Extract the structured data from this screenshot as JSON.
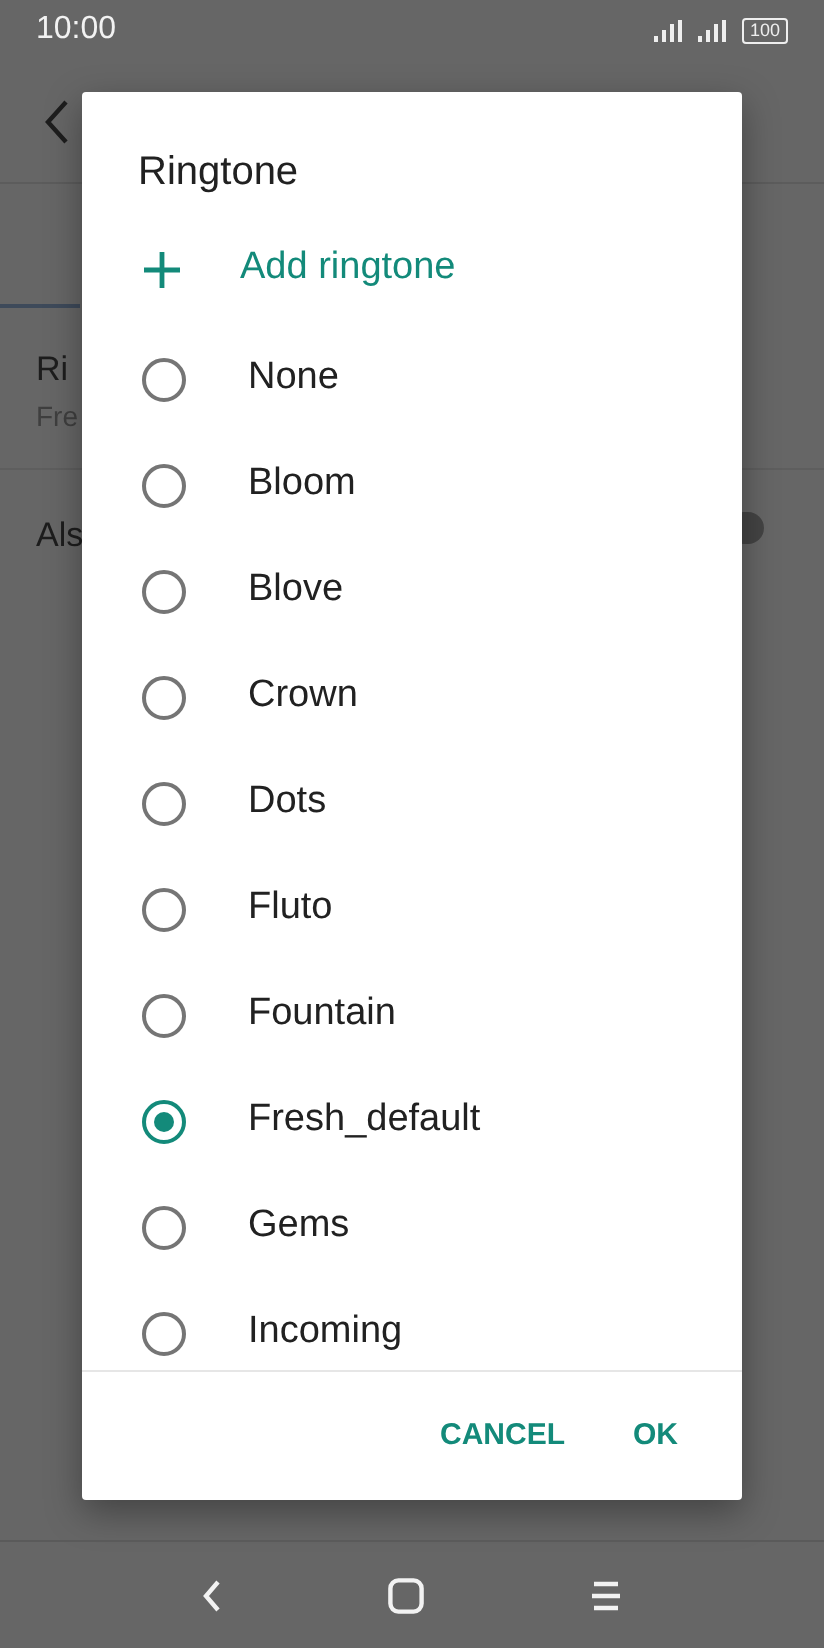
{
  "status_bar": {
    "time": "10:00",
    "battery": "100"
  },
  "background": {
    "setting_title": "Ri",
    "setting_value": "Fre",
    "setting_2": "Als",
    "toggle_on": false
  },
  "dialog": {
    "title": "Ringtone",
    "add_label": "Add ringtone",
    "options": [
      {
        "label": "None",
        "selected": false
      },
      {
        "label": "Bloom",
        "selected": false
      },
      {
        "label": "Blove",
        "selected": false
      },
      {
        "label": "Crown",
        "selected": false
      },
      {
        "label": "Dots",
        "selected": false
      },
      {
        "label": "Fluto",
        "selected": false
      },
      {
        "label": "Fountain",
        "selected": false
      },
      {
        "label": "Fresh_default",
        "selected": true
      },
      {
        "label": "Gems",
        "selected": false
      },
      {
        "label": "Incoming",
        "selected": false
      }
    ],
    "buttons": [
      {
        "label": "CANCEL"
      },
      {
        "label": "OK"
      }
    ]
  }
}
